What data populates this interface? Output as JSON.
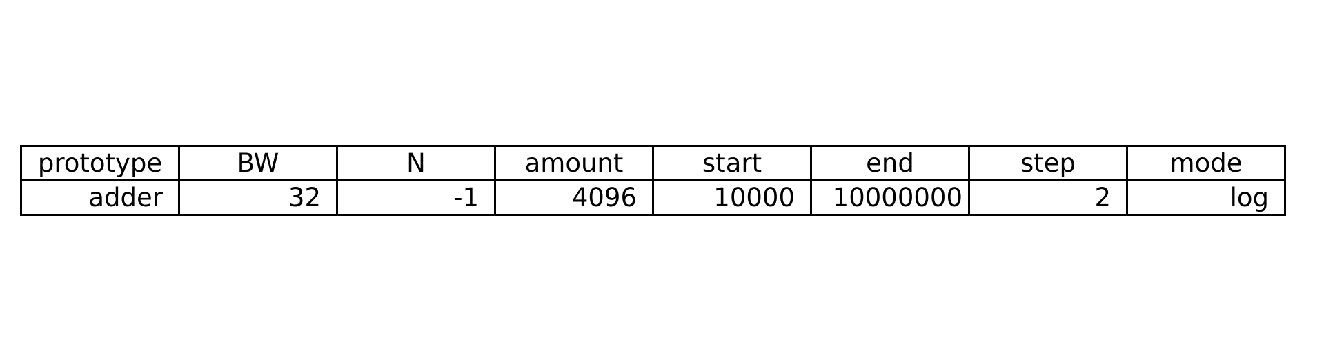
{
  "chart_data": {
    "type": "table",
    "columns": [
      "prototype",
      "BW",
      "N",
      "amount",
      "start",
      "end",
      "step",
      "mode"
    ],
    "rows": [
      [
        "adder",
        "32",
        "-1",
        "4096",
        "10000",
        "10000000",
        "2",
        "log"
      ]
    ]
  }
}
